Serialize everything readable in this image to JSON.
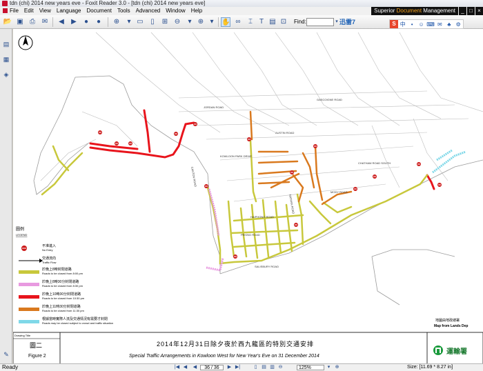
{
  "window": {
    "title": "tdn (chi) 2014 new years eve - Foxit Reader 3.0 - [tdn (chi) 2014 new years eve]"
  },
  "menu": {
    "items": [
      "File",
      "Edit",
      "View",
      "Language",
      "Document",
      "Tools",
      "Advanced",
      "Window",
      "Help"
    ]
  },
  "brand": {
    "prefix": "Superior ",
    "accent": "Document",
    "suffix": " Management"
  },
  "toolbar": {
    "find_label": "Find:",
    "find_value": "",
    "xunlei_label": "迅雷7"
  },
  "ime": {
    "items": [
      "S",
      "中",
      "•",
      "☺",
      "⌨",
      "✉",
      "♣",
      "⚙"
    ]
  },
  "document": {
    "legend": {
      "title_zh": "圖例",
      "title_en": "LEGEND",
      "entries": [
        {
          "zh": "不准進入",
          "en": "No Entry",
          "color": "#cc1a1a"
        },
        {
          "zh": "交通流向",
          "en": "Traffic Flow",
          "color": "#000000"
        },
        {
          "zh": "於晚上8時封閉道路",
          "en": "Roads to be closed from 8:00 pm",
          "color": "#c8c83c"
        },
        {
          "zh": "於晚上8時30分封閉道路",
          "en": "Roads to be closed from 8:30 pm",
          "color": "#e89ae0"
        },
        {
          "zh": "於晚上10時30分封閉道路",
          "en": "Roads to be closed from 10:30 pm",
          "color": "#e8141c"
        },
        {
          "zh": "於晚上11時30分封閉道路",
          "en": "Roads to be closed from 11:30 pm",
          "color": "#d9791e"
        },
        {
          "zh": "根據當時實際人流及交通情況有需要才封閉",
          "en": "Roads may be closed subject to crowd and traffic situation",
          "color": "#7fd8e8"
        }
      ]
    },
    "road_labels": [
      "JORDAN ROAD",
      "AUSTIN ROAD",
      "GASCOIGNE ROAD",
      "CANTON ROAD",
      "KOWLOON PARK DRIVE",
      "SALISBURY ROAD",
      "NATHAN ROAD",
      "CHATHAM ROAD SOUTH",
      "PEKING ROAD",
      "HAIPHONG ROAD",
      "MODY ROAD"
    ],
    "map_credit_zh": "地圖由地政總署",
    "map_credit_en": "Map from Lands Dep",
    "drawing_title": "Drawing Title",
    "figure_zh": "圖二",
    "figure_en": "Figure 2",
    "title_zh": "2014年12月31日除夕夜於西九龍區的特別交通安排",
    "title_en": "Special Traffic Arrangements in Kowloon West for New Year's Eve on 31 December 2014",
    "department_zh": "運輸署"
  },
  "status": {
    "ready": "Ready",
    "page": "36 / 36",
    "zoom": "125%",
    "size": "Size: [11.69 * 8.27 in]"
  },
  "colors": {
    "road_8pm": "#c8c83c",
    "road_830pm": "#e89ae0",
    "road_1030pm": "#e8141c",
    "road_1130pm": "#d9791e",
    "road_subject": "#7fd8e8",
    "brand_accent": "#f6a21a"
  }
}
